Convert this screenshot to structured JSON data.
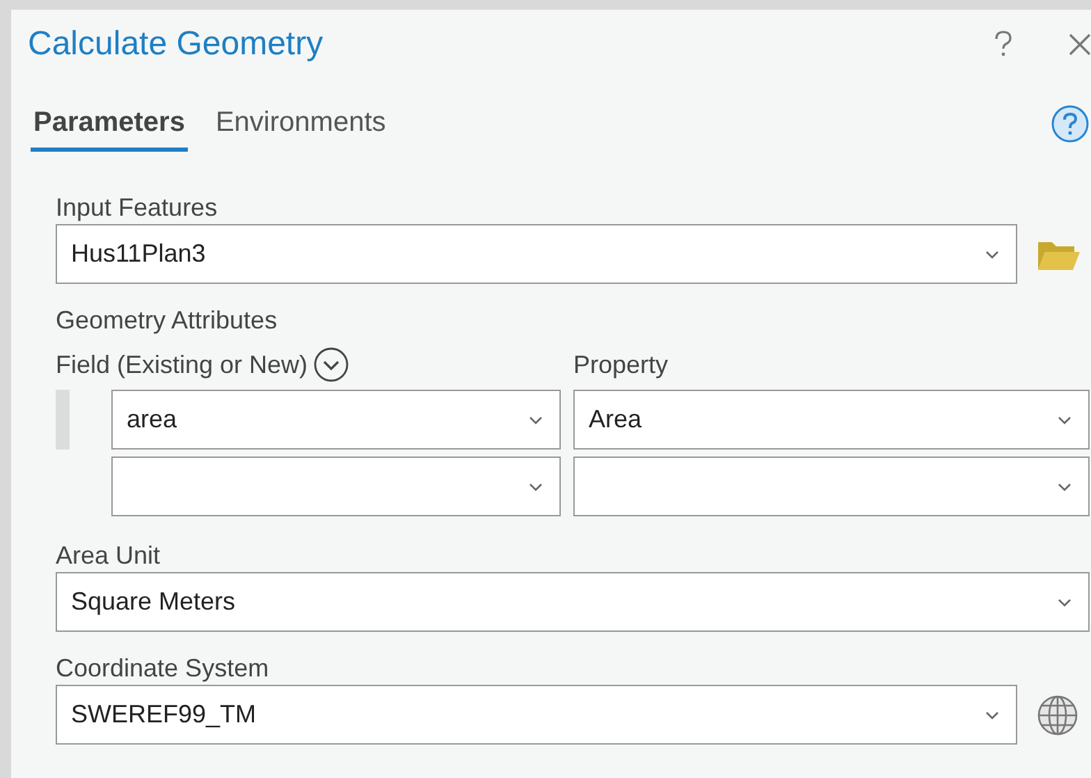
{
  "dialog": {
    "title": "Calculate Geometry"
  },
  "tabs": [
    {
      "label": "Parameters",
      "selected": true
    },
    {
      "label": "Environments",
      "selected": false
    }
  ],
  "input_features": {
    "label": "Input Features",
    "value": "Hus11Plan3"
  },
  "geometry_attributes": {
    "label": "Geometry Attributes",
    "field_label": "Field (Existing or New)",
    "property_label": "Property",
    "rows": [
      {
        "field": "area",
        "property": "Area"
      },
      {}
    ]
  },
  "area_unit": {
    "label": "Area Unit",
    "value": "Square Meters"
  },
  "coordinate_system": {
    "label": "Coordinate System",
    "value": "SWEREF99_TM"
  }
}
